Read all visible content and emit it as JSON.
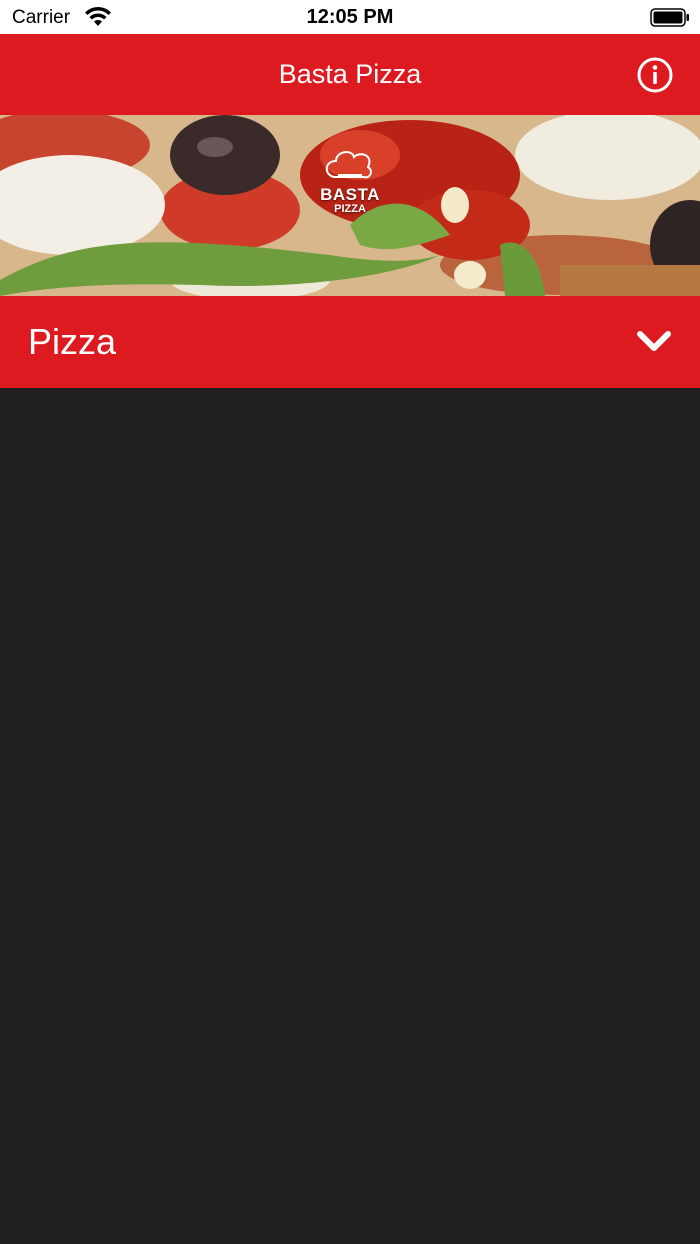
{
  "status_bar": {
    "carrier": "Carrier",
    "time": "12:05 PM"
  },
  "nav": {
    "title": "Basta Pizza",
    "info_icon": "info-circle-icon"
  },
  "banner": {
    "logo_line1": "BASTA",
    "logo_line2": "PIZZA"
  },
  "category": {
    "label": "Pizza",
    "expand_icon": "chevron-down-icon"
  },
  "colors": {
    "brand_red": "#dc1a20",
    "background": "#202020"
  }
}
